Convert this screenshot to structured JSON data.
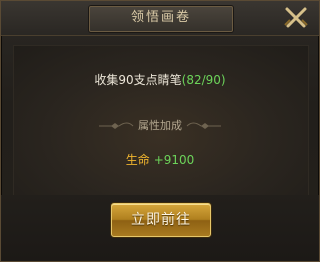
{
  "dialog": {
    "title": "领悟画卷",
    "close_icon": "crossed-swords-close-icon"
  },
  "task": {
    "label": "收集90支点睛笔",
    "progress": "(82/90)",
    "progress_color": "#6cd35a"
  },
  "attributes": {
    "header": "属性加成",
    "items": [
      {
        "name": "生命",
        "value": "+9100"
      }
    ],
    "name_color": "#f0b52f",
    "value_color": "#6cd35a"
  },
  "actions": {
    "go_label": "立即前往"
  }
}
